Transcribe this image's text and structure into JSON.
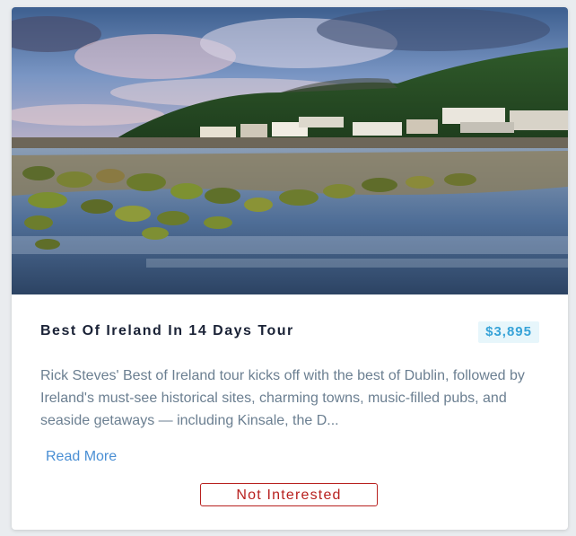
{
  "card": {
    "image_alt": "Coastal village with seaweed-covered rocks",
    "title": "Best Of Ireland In 14 Days Tour",
    "price": "$3,895",
    "description": "Rick Steves' Best of Ireland tour kicks off with the best of Dublin, followed by Ireland's must-see historical sites, charming towns, music-filled pubs, and seaside getaways — including Kinsale, the D...",
    "read_more_label": "Read More",
    "not_interested_label": "Not Interested"
  },
  "colors": {
    "price_text": "#37a3d8",
    "price_bg": "#e7f6fb",
    "link": "#4a8fd4",
    "danger": "#b8211f",
    "title": "#1a2236",
    "body_text": "#6b7f91"
  }
}
